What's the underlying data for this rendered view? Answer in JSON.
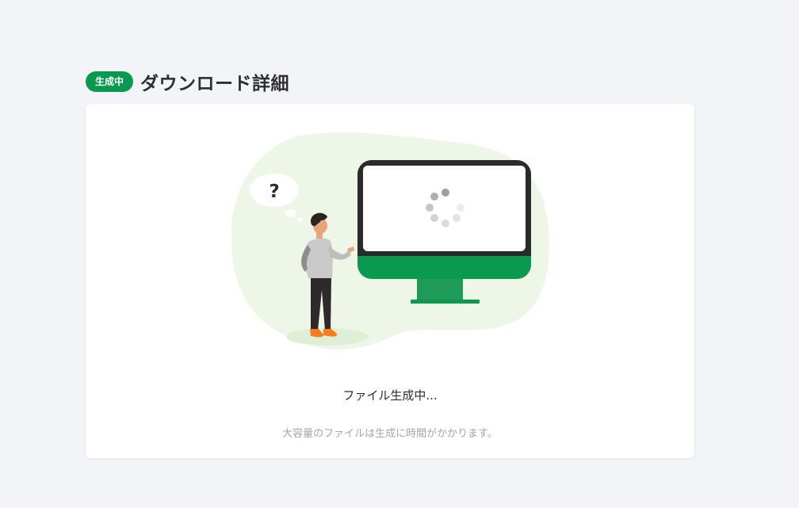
{
  "header": {
    "badge": "生成中",
    "title": "ダウンロード詳細"
  },
  "illustration": {
    "thought_symbol": "?",
    "icons": [
      "thought-bubble-icon",
      "monitor-icon",
      "loading-spinner-icon",
      "person-icon"
    ]
  },
  "status": {
    "message": "ファイル生成中...",
    "note": "大容量のファイルは生成に時間がかかります。"
  },
  "colors": {
    "brand_green": "#0a9a4f",
    "background": "#f3f4f7",
    "blob": "#eef6e8",
    "accent_orange": "#f57c1f"
  }
}
